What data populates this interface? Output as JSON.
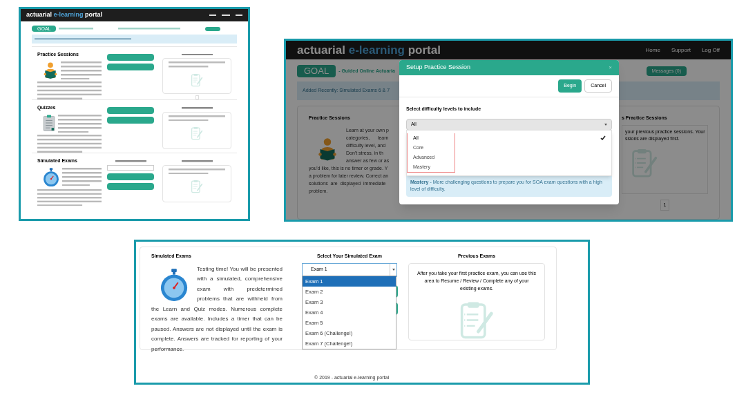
{
  "overview_page": {
    "logo": [
      "actuarial",
      "e-learning",
      "portal"
    ],
    "badge": "GOAL",
    "sections": [
      {
        "kind": "practice",
        "title": "Practice Sessions"
      },
      {
        "kind": "quiz",
        "title": "Quizzes"
      },
      {
        "kind": "exam",
        "title": "Simulated Exams"
      }
    ]
  },
  "practice_setup_page": {
    "logo": [
      "actuarial",
      "e-learning",
      "portal"
    ],
    "nav": [
      "Home",
      "Support",
      "Log Off"
    ],
    "badge": "GOAL",
    "tagline": "- Guided Online Actuaria",
    "messages": "Messages (0)",
    "alert": "Added Recently: Simulated Exams 6 & 7",
    "section_title": "Practice Sessions",
    "description_lines": [
      "Learn at your own p",
      "categories,      learn",
      "difficulty level, and",
      "Don't stress, in th",
      "answer as few or as",
      "you'd like, this is no timer or grade. Y",
      "a problem for later review. Correct an",
      "solutions  are  displayed  immediate",
      "problem."
    ],
    "history_title": "s Practice Sessions",
    "history_lines": [
      "your previous practice sessions. Your",
      "ssions are displayed first."
    ],
    "pages": [
      "1"
    ],
    "dialog": {
      "title": "Setup Practice Session",
      "close": "×",
      "buttons": [
        "Begin",
        "Cancel"
      ],
      "label": "Select difficulty levels to include",
      "value": "All",
      "options": [
        {
          "label": "All",
          "selected": true
        },
        {
          "label": "Core",
          "selected": false
        },
        {
          "label": "Advanced",
          "selected": false
        },
        {
          "label": "Mastery",
          "selected": false
        }
      ],
      "note": "**Mastery** - More challenging questions to prepare you for SOA exam questions with a high level of difficulty."
    }
  },
  "exams_page": {
    "title": "Simulated Exams",
    "description": "Testing time! You will be presented with a simulated, comprehensive exam with predetermined problems that are withheld from the Learn and Quiz modes. Numerous complete exams are available. Includes a timer that can be paused. Answers are not displayed until the exam is complete. Answers are tracked for reporting of your performance.",
    "select_label": "Select Your Simulated Exam",
    "select_value": "Exam 1",
    "options": [
      {
        "label": "Exam 1",
        "selected": true
      },
      {
        "label": "Exam 2",
        "selected": false
      },
      {
        "label": "Exam 3",
        "selected": false
      },
      {
        "label": "Exam 4",
        "selected": false
      },
      {
        "label": "Exam 5",
        "selected": false
      },
      {
        "label": "Exam 6 (Challenge!)",
        "selected": false
      },
      {
        "label": "Exam 7 (Challenge!)",
        "selected": false
      }
    ],
    "history_title": "Previous Exams",
    "history_text": "After you take your first practice exam, you can use this area to Resume / Review / Complete any of your existing exams.",
    "footer": "© 2019 - actuarial e-learning portal"
  }
}
